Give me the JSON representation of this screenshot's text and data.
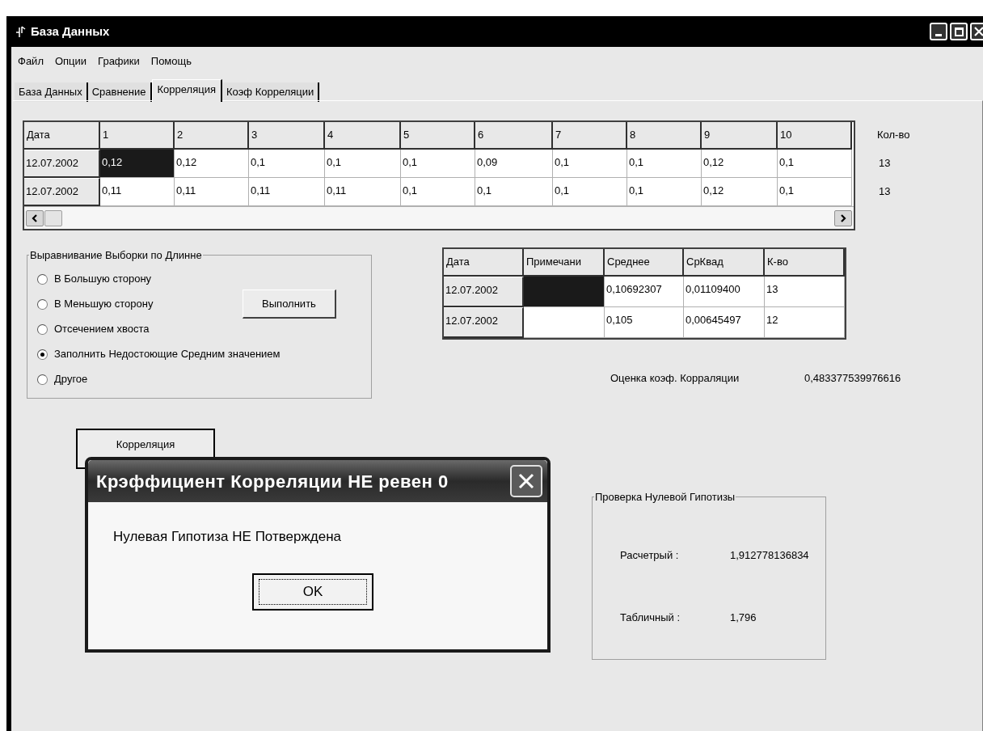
{
  "window": {
    "title": "База Данных"
  },
  "menu": [
    "Файл",
    "Опции",
    "Графики",
    "Помощь"
  ],
  "tabs": [
    {
      "label": "База Данных",
      "selected": false
    },
    {
      "label": "Сравнение",
      "selected": false
    },
    {
      "label": "Корреляция",
      "selected": true
    },
    {
      "label": "Коэф Корреляции",
      "selected": false
    }
  ],
  "data_grid": {
    "columns": [
      "Дата",
      "1",
      "2",
      "3",
      "4",
      "5",
      "6",
      "7",
      "8",
      "9",
      "10"
    ],
    "rows": [
      {
        "cells": [
          {
            "kind": "row_header",
            "text": "12.07.2002"
          },
          {
            "text": "0,12",
            "selected": true
          },
          {
            "text": "0,12",
            "selected": false
          },
          {
            "text": "0,1",
            "selected": false
          },
          {
            "text": "0,1",
            "selected": false
          },
          {
            "text": "0,1",
            "selected": false
          },
          {
            "text": "0,09",
            "selected": false
          },
          {
            "text": "0,1",
            "selected": false
          },
          {
            "text": "0,1",
            "selected": false
          },
          {
            "text": "0,12",
            "selected": false
          },
          {
            "text": "0,1",
            "selected": false
          }
        ]
      },
      {
        "cells": [
          {
            "kind": "row_header",
            "text": "12.07.2002"
          },
          {
            "text": "0,11",
            "selected": false
          },
          {
            "text": "0,11",
            "selected": false
          },
          {
            "text": "0,11",
            "selected": false
          },
          {
            "text": "0,11",
            "selected": false
          },
          {
            "text": "0,1",
            "selected": false
          },
          {
            "text": "0,1",
            "selected": false
          },
          {
            "text": "0,1",
            "selected": false
          },
          {
            "text": "0,1",
            "selected": false
          },
          {
            "text": "0,12",
            "selected": false
          },
          {
            "text": "0,1",
            "selected": false
          }
        ]
      }
    ]
  },
  "count_column": {
    "label": "Кол-во",
    "values": [
      "13",
      "13"
    ]
  },
  "alignment_group": {
    "legend": "Выравнивание Выборки по Длинне",
    "options": [
      {
        "label": "В Большую сторону",
        "selected": false
      },
      {
        "label": "В Меньшую сторону",
        "selected": false
      },
      {
        "label": "Отсечением хвоста",
        "selected": false
      },
      {
        "label": "Заполнить Недостоющие Средним значением",
        "selected": true
      },
      {
        "label": "Другое",
        "selected": false
      }
    ],
    "button": "Выполнить"
  },
  "stats_grid": {
    "columns": [
      "Дата",
      "Примечани",
      "Среднее",
      "СрКвад",
      "К-во"
    ],
    "rows": [
      {
        "cells": [
          {
            "kind": "row_header",
            "text": "12.07.2002"
          },
          {
            "selected": true
          },
          {
            "text": "0,10692307",
            "selected": false
          },
          {
            "text": "0,01109400",
            "selected": false
          },
          {
            "text": "13",
            "selected": false
          }
        ]
      },
      {
        "cells": [
          {
            "kind": "row_header",
            "text": "12.07.2002"
          },
          {
            "selected": false
          },
          {
            "text": "0,105",
            "selected": false
          },
          {
            "text": "0,00645497",
            "selected": false
          },
          {
            "text": "12",
            "selected": false
          }
        ]
      }
    ]
  },
  "correlation_estimate": {
    "label": "Оценка коэф. Корраляции",
    "value": "0,483377539976616"
  },
  "correlation_button": "Корреляция",
  "hypothesis_group": {
    "legend": "Проверка Нулевой Гипотизы",
    "rows": [
      {
        "label": "Расчетрый :",
        "value": "1,912778136834"
      },
      {
        "label": "Табличный :",
        "value": "1,796"
      }
    ]
  },
  "dialog": {
    "title": "Крэффициент Корреляции НЕ ревен 0",
    "message": "Нулевая Гипотиза НЕ Потверждена",
    "button": "OK"
  }
}
